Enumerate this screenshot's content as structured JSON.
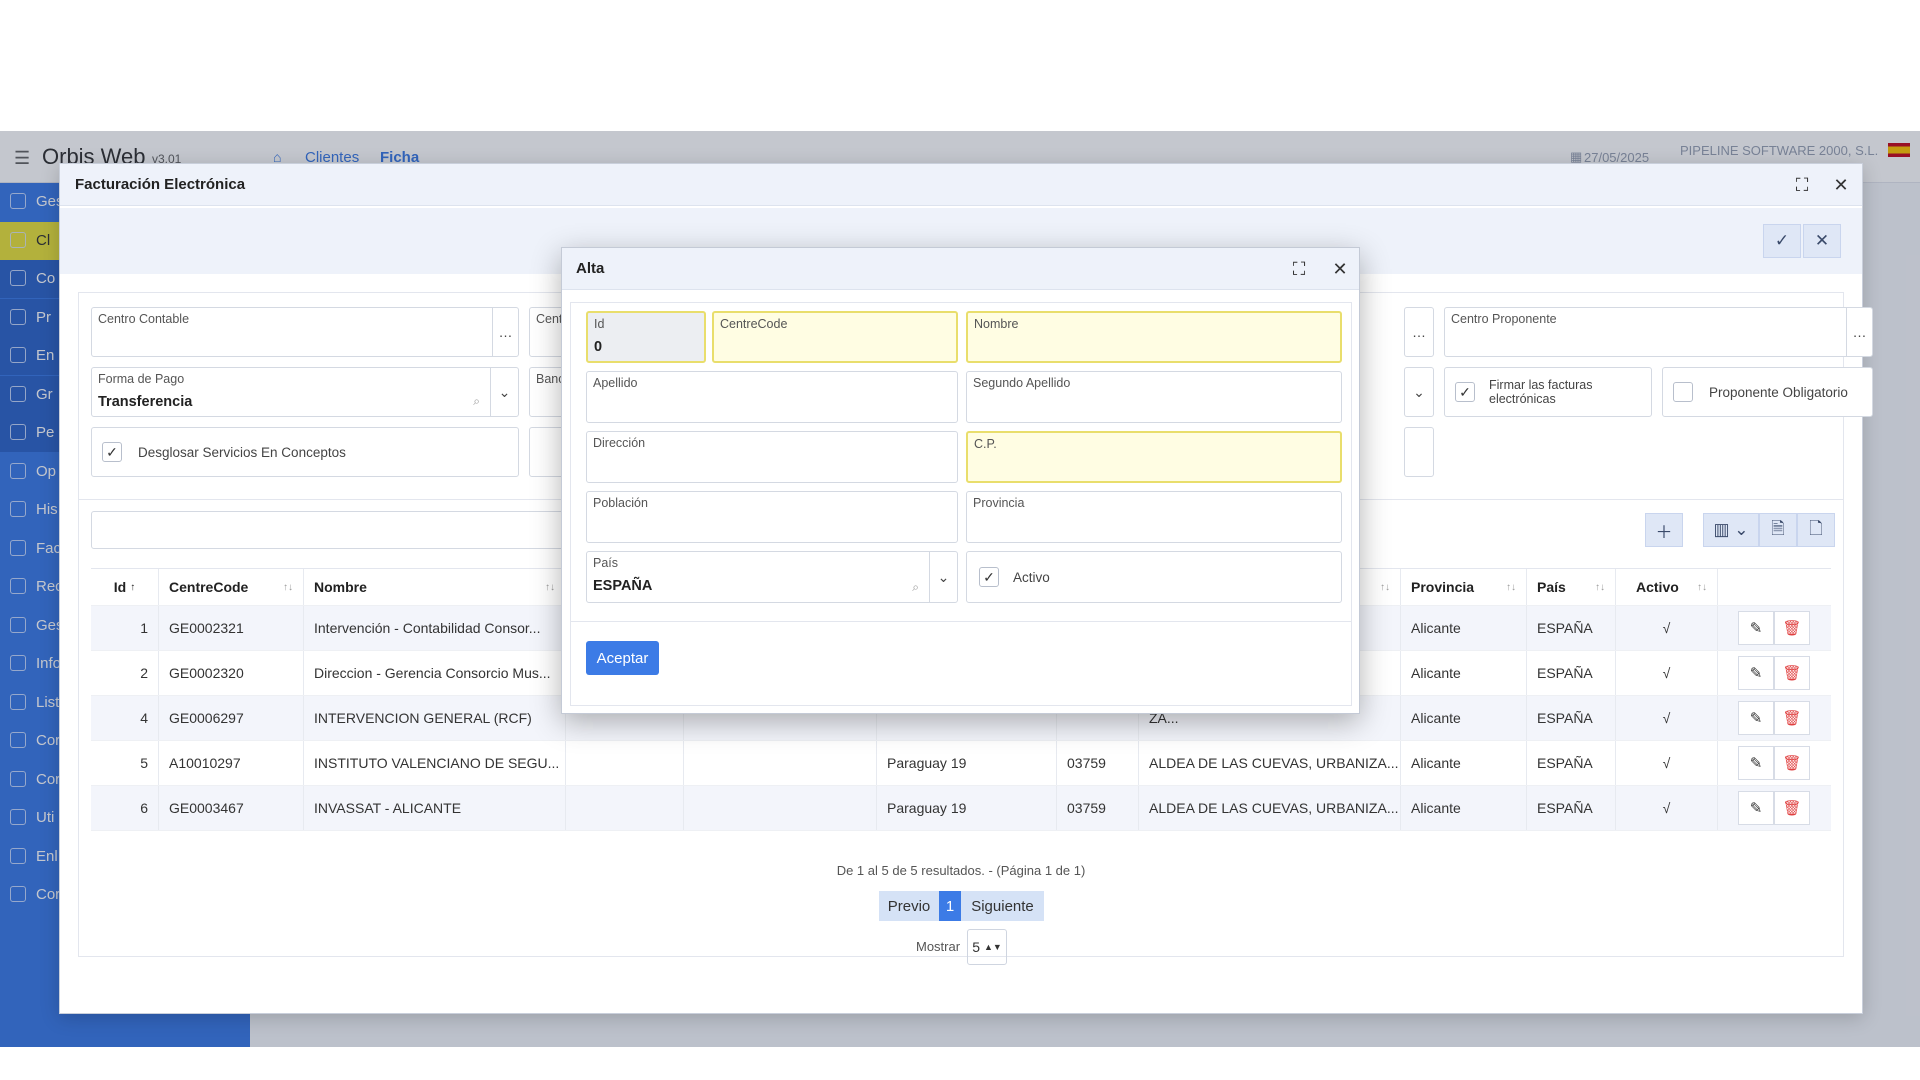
{
  "app": {
    "name": "Orbis Web",
    "version": "v3.01",
    "breadcrumb": [
      "Clientes",
      "Ficha"
    ],
    "date": "27/05/2025",
    "company": "PIPELINE SOFTWARE 2000, S.L."
  },
  "sidebar": {
    "items": [
      "Ges",
      "Cl",
      "Co",
      "Pr",
      "En",
      "Gr",
      "Pe",
      "Op",
      "His",
      "Fac",
      "Rec",
      "Ges",
      "Info",
      "List",
      "Cor",
      "Cor",
      "Uti",
      "Enl",
      "Cor"
    ]
  },
  "background": {
    "tab_label": "es"
  },
  "fe": {
    "title": "Facturación Electrónica",
    "fields": {
      "centro_contable": "Centro Contable",
      "cent": "Cent",
      "centro_proponente": "Centro Proponente",
      "forma_pago_label": "Forma de Pago",
      "forma_pago_value": "Transferencia",
      "banc": "Banc",
      "firmar": "Firmar las facturas electrónicas",
      "proponente": "Proponente Obligatorio",
      "desglosar": "Desglosar Servicios En Conceptos"
    },
    "table": {
      "headers": {
        "id": "Id",
        "centrecode": "CentreCode",
        "nombre": "Nombre",
        "provincia": "Provincia",
        "pais": "País",
        "activo": "Activo"
      },
      "rows": [
        {
          "id": "1",
          "code": "GE0002321",
          "nombre": "Intervención - Contabilidad Consor...",
          "dir": "",
          "cp": "",
          "pob": "",
          "prov": "Alicante",
          "pais": "ESPAÑA",
          "activo": "√"
        },
        {
          "id": "2",
          "code": "GE0002320",
          "nombre": "Direccion - Gerencia Consorcio Mus...",
          "dir": "",
          "cp": "",
          "pob": "",
          "prov": "Alicante",
          "pais": "ESPAÑA",
          "activo": "√"
        },
        {
          "id": "4",
          "code": "GE0006297",
          "nombre": "INTERVENCION GENERAL (RCF)",
          "dir": "",
          "cp": "",
          "pob": "ZA...",
          "prov": "Alicante",
          "pais": "ESPAÑA",
          "activo": "√"
        },
        {
          "id": "5",
          "code": "A10010297",
          "nombre": "INSTITUTO VALENCIANO DE SEGU...",
          "dir": "Paraguay 19",
          "cp": "03759",
          "pob": "ALDEA DE LAS CUEVAS, URBANIZA...",
          "prov": "Alicante",
          "pais": "ESPAÑA",
          "activo": "√"
        },
        {
          "id": "6",
          "code": "GE0003467",
          "nombre": "INVASSAT - ALICANTE",
          "dir": "Paraguay 19",
          "cp": "03759",
          "pob": "ALDEA DE LAS CUEVAS, URBANIZA...",
          "prov": "Alicante",
          "pais": "ESPAÑA",
          "activo": "√"
        }
      ]
    },
    "pagination": {
      "summary": "De 1 al 5 de 5 resultados. - (Página 1 de 1)",
      "prev": "Previo",
      "page": "1",
      "next": "Siguiente",
      "show_label": "Mostrar",
      "show_value": "5"
    }
  },
  "alta": {
    "title": "Alta",
    "fields": {
      "id_label": "Id",
      "id_value": "0",
      "centrecode": "CentreCode",
      "nombre": "Nombre",
      "apellido": "Apellido",
      "segundo": "Segundo Apellido",
      "direccion": "Dirección",
      "cp": "C.P.",
      "poblacion": "Población",
      "provincia": "Provincia",
      "pais_label": "País",
      "pais_value": "ESPAÑA",
      "activo": "Activo"
    },
    "accept": "Aceptar"
  }
}
